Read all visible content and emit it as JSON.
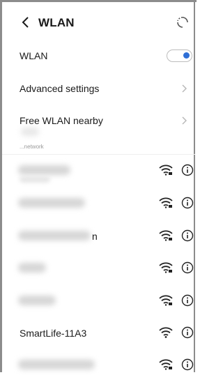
{
  "header": {
    "title": "WLAN"
  },
  "settings": {
    "wlan_label": "WLAN",
    "wlan_on": true,
    "advanced_label": "Advanced settings",
    "free_label": "Free WLAN nearby"
  },
  "section_label": "...network",
  "networks": [
    {
      "name": "",
      "blurred": true,
      "secured": true
    },
    {
      "name": "",
      "blurred": true,
      "secured": true
    },
    {
      "name": "n",
      "blurred": true,
      "secured": true
    },
    {
      "name": "",
      "blurred": true,
      "secured": true
    },
    {
      "name": "",
      "blurred": true,
      "secured": true
    },
    {
      "name": "SmartLife-11A3",
      "blurred": false,
      "secured": false
    },
    {
      "name": "",
      "blurred": true,
      "secured": true
    }
  ],
  "colors": {
    "accent": "#2f6fd6",
    "text": "#1a1a1a"
  }
}
